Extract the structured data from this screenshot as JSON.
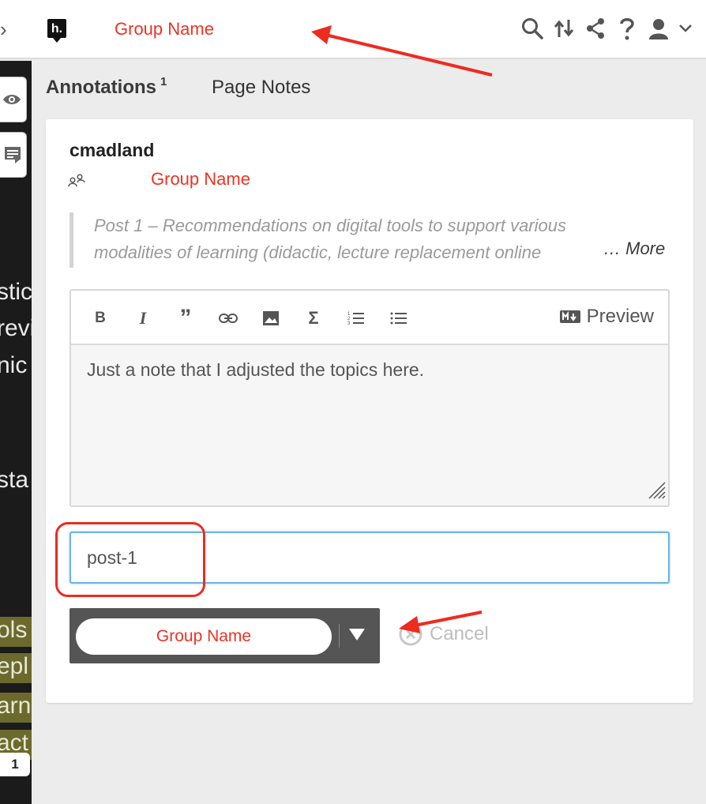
{
  "topbar": {
    "collapse_icon": "chevron-right-icon",
    "logo_icon": "h-logo-icon",
    "logo_text": "h.",
    "group_name": "Group Name",
    "icons": [
      "search-icon",
      "sort-icon",
      "share-icon",
      "help-icon",
      "user-icon",
      "chevron-down-icon"
    ]
  },
  "left_page": {
    "buttons": [
      "eye-icon",
      "notes-icon"
    ],
    "fragments": [
      "stic",
      "revi",
      "nic",
      "sta"
    ],
    "highlighted_fragments": [
      "ols",
      "epl",
      "arn",
      "act"
    ],
    "badge_count": "1"
  },
  "tabs": {
    "annotations_label": "Annotations",
    "annotations_count": "1",
    "page_notes_label": "Page Notes"
  },
  "card": {
    "username": "cmadland",
    "group_icon": "group-icon",
    "group_name": "Group Name",
    "quote_text": "Post 1 – Recommendations on digital tools to support various\nmodalities of learning (didactic, lecture replacement online",
    "more_label": "… More",
    "editor": {
      "toolbar_icons": [
        "bold-icon",
        "italic-icon",
        "quote-icon",
        "link-icon",
        "image-icon",
        "math-icon",
        "numbered-list-icon",
        "bullet-list-icon"
      ],
      "preview_label": "Preview",
      "body_text": "Just a note that I adjusted the topics here."
    },
    "tags_value": "post-1",
    "post_button_label": "Group Name",
    "cancel_label": "Cancel"
  },
  "colors": {
    "accent_red": "#ee3322",
    "tag_border": "#6ab4e6",
    "post_button_bg": "#555555"
  }
}
